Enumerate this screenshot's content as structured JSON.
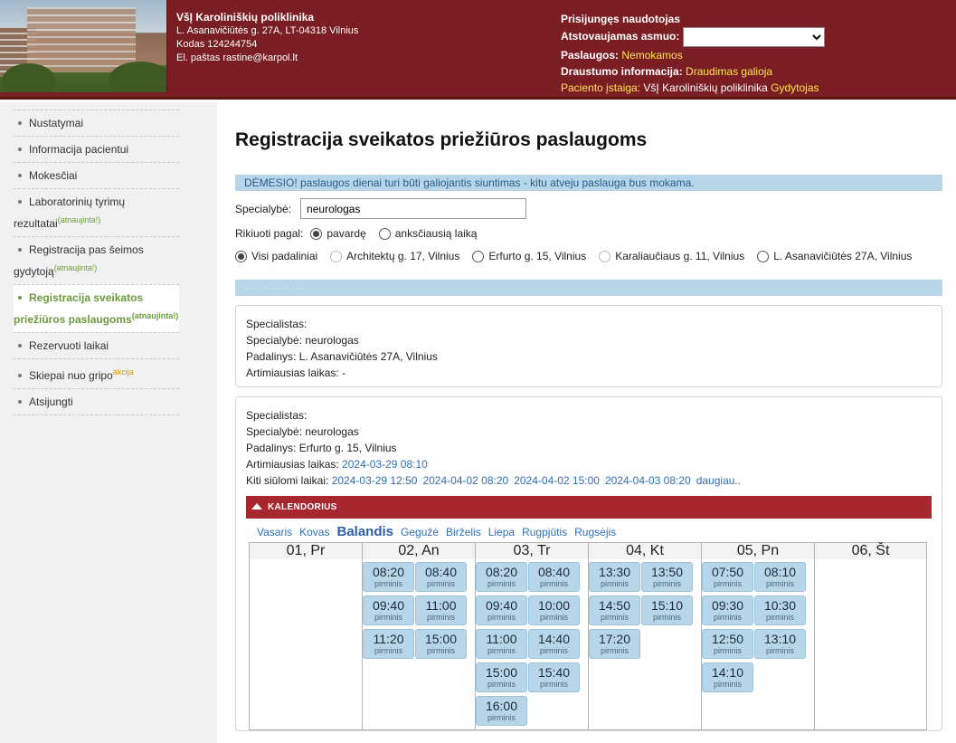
{
  "header": {
    "org_name": "VšĮ Karoliniškių poliklinika",
    "address": "L. Asanavičiūtės g. 27A, LT-04318 Vilnius",
    "code": "Kodas 124244754",
    "email": "El. paštas rastine@karpol.lt",
    "logged_in": "Prisijungęs naudotojas",
    "represented_label": "Atstovaujamas asmuo:",
    "services_label": "Paslaugos:",
    "services_value": "Nemokamos",
    "insurance_label": "Draustumo informacija:",
    "insurance_value": "Draudimas galioja",
    "institution_label": "Paciento įstaiga:",
    "institution_value": "VšĮ Karoliniškių poliklinika",
    "institution_role": "Gydytojas"
  },
  "sidebar": {
    "items": [
      {
        "label": "Nustatymai",
        "sup": ""
      },
      {
        "label": "Informacija pacientui",
        "sup": ""
      },
      {
        "label": "Mokesčiai",
        "sup": ""
      },
      {
        "label": "Laboratorinių tyrimų rezultatai",
        "sup": "(atnaujinta!)"
      },
      {
        "label": "Registracija pas šeimos gydytoją",
        "sup": "(atnaujinta!)"
      },
      {
        "label": "Registracija sveikatos priežiūros paslaugoms",
        "sup": "(atnaujinta!)"
      },
      {
        "label": "Rezervuoti laikai",
        "sup": ""
      },
      {
        "label": "Skiepai nuo gripo",
        "sup": "akcija"
      },
      {
        "label": "Atsijungti",
        "sup": ""
      }
    ]
  },
  "main": {
    "title": "Registracija sveikatos priežiūros paslaugoms",
    "notice": "DĖMESIO! paslaugos dienai turi būti galiojantis siuntimas - kitu atveju paslauga bus mokama.",
    "specialty_label": "Specialybė:",
    "specialty_value": "neurologas",
    "sort_label": "Rikiuoti pagal:",
    "sort_opt1": "pavardę",
    "sort_opt2": "anksčiausią laiką",
    "branches": [
      "Visi padaliniai",
      "Architektų g. 17, Vilnius",
      "Erfurto g. 15, Vilnius",
      "Karaliaučiaus g. 11, Vilnius",
      "L. Asanavičiūtės 27A, Vilnius"
    ],
    "blurred_bar": "..... ..... ....."
  },
  "card1": {
    "specialist": "Specialistas:",
    "specialty": "Specialybė: neurologas",
    "branch": "Padalinys: L. Asanavičiūtės 27A, Vilnius",
    "nearest": "Artimiausias laikas: -"
  },
  "card2": {
    "specialist": "Specialistas:",
    "specialty": "Specialybė: neurologas",
    "branch": "Padalinys: Erfurto g. 15, Vilnius",
    "nearest_label": "Artimiausias laikas:",
    "nearest_value": "2024-03-29 08:10",
    "other_label": "Kiti siūlomi laikai:",
    "other_times": [
      "2024-03-29 12:50",
      "2024-04-02 08:20",
      "2024-04-02 15:00",
      "2024-04-03 08:20",
      "daugiau.."
    ]
  },
  "calendar": {
    "header": "KALENDORIUS",
    "months": [
      "Vasaris",
      "Kovas",
      "Balandis",
      "Gegužė",
      "Birželis",
      "Liepa",
      "Rugpjūtis",
      "Rugsėjis"
    ],
    "current_month": "Balandis",
    "slot_note": "pirminis",
    "days": [
      {
        "label": "01, Pr",
        "slots": []
      },
      {
        "label": "02, An",
        "slots": [
          "08:20",
          "08:40",
          "09:40",
          "11:00",
          "11:20",
          "15:00"
        ]
      },
      {
        "label": "03, Tr",
        "slots": [
          "08:20",
          "08:40",
          "09:40",
          "10:00",
          "11:00",
          "14:40",
          "15:00",
          "15:40",
          "16:00"
        ]
      },
      {
        "label": "04, Kt",
        "slots": [
          "13:30",
          "13:50",
          "14:50",
          "15:10",
          "17:20"
        ]
      },
      {
        "label": "05, Pn",
        "slots": [
          "07:50",
          "08:10",
          "09:30",
          "10:30",
          "12:50",
          "13:10",
          "14:10"
        ]
      },
      {
        "label": "06, Št",
        "slots": []
      }
    ]
  }
}
